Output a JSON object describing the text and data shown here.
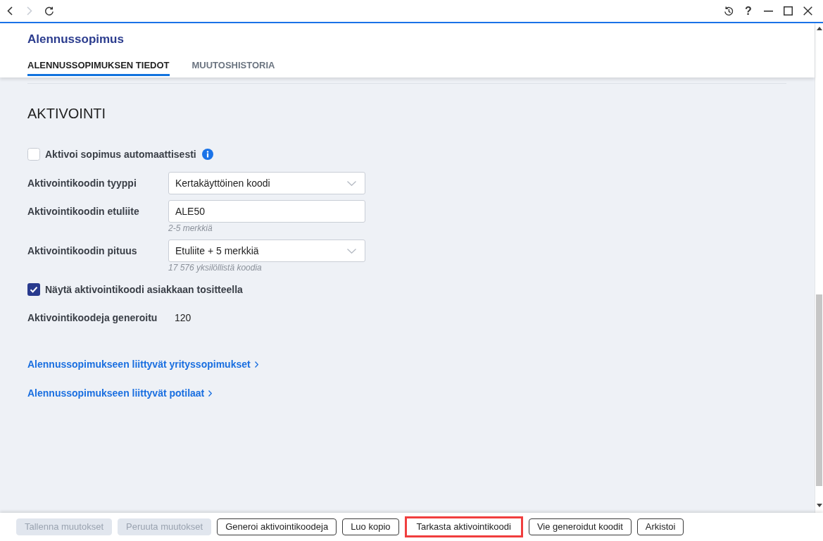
{
  "toolbar": {
    "nav_buttons": [
      {
        "kind": "back",
        "disabled": false
      },
      {
        "kind": "forward",
        "disabled": true
      },
      {
        "kind": "refresh",
        "disabled": false
      }
    ],
    "help": "?"
  },
  "page": {
    "title": "Alennussopimus"
  },
  "tabs": [
    {
      "label": "ALENNUSSOPIMUKSEN TIEDOT",
      "selected": true
    },
    {
      "label": "MUUTOSHISTORIA",
      "selected": false
    }
  ],
  "section": {
    "heading": "AKTIVOINTI",
    "fields": [
      {
        "kind": "checkbox",
        "label": "Aktivoi sopimus automaattisesti",
        "checked": false,
        "info": true
      },
      {
        "kind": "select",
        "label": "Aktivointikoodin tyyppi",
        "value": "Kertakäyttöinen koodi"
      },
      {
        "kind": "text",
        "label": "Aktivointikoodin etuliite",
        "value": "ALE50",
        "hint": "2-5 merkkiä"
      },
      {
        "kind": "select",
        "label": "Aktivointikoodin pituus",
        "value": "Etuliite + 5 merkkiä",
        "hint": "17 576 yksilöllistä koodia"
      },
      {
        "kind": "checkbox",
        "label": "Näytä aktivointikoodi asiakkaan tositteella",
        "checked": true,
        "info": false
      },
      {
        "kind": "readonly",
        "label": "Aktivointikoodeja generoitu",
        "value": "120"
      }
    ]
  },
  "links": [
    {
      "label": "Alennussopimukseen liittyvät yrityssopimukset"
    },
    {
      "label": "Alennussopimukseen liittyvät potilaat"
    }
  ],
  "buttons": [
    {
      "label": "Tallenna muutokset",
      "disabled": true,
      "highlighted": false
    },
    {
      "label": "Peruuta muutokset",
      "disabled": true,
      "highlighted": false
    },
    {
      "label": "Generoi aktivointikoodeja",
      "disabled": false,
      "highlighted": false
    },
    {
      "label": "Luo kopio",
      "disabled": false,
      "highlighted": false
    },
    {
      "label": "Tarkasta aktivointikoodi",
      "disabled": false,
      "highlighted": true
    },
    {
      "label": "Vie generoidut koodit",
      "disabled": false,
      "highlighted": false
    },
    {
      "label": "Arkistoi",
      "disabled": false,
      "highlighted": false
    }
  ]
}
